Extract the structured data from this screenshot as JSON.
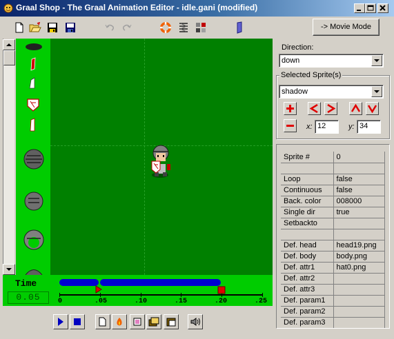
{
  "window": {
    "title": "Graal Shop - The Graal Animation Editor - idle.gani (modified)",
    "controls": [
      "minimize",
      "maximize",
      "close"
    ]
  },
  "toolbar": {
    "icons": [
      "new-file-icon",
      "open-folder-icon",
      "save-icon",
      "save-as-icon",
      "undo-icon",
      "redo-icon",
      "lifebuoy-icon",
      "spring-icon",
      "sprites-icon",
      "book-icon"
    ],
    "movie_mode_label": "-> Movie Mode"
  },
  "colors": {
    "canvas": "#008000",
    "sprite_bg": "#00cc00",
    "timeline_bar": "#0000d0",
    "marker": "#e00000"
  },
  "time": {
    "label": "Time",
    "value": "0.05"
  },
  "timeline": {
    "ticks": [
      "0",
      ".05",
      ".10",
      ".15",
      ".20",
      ".25"
    ],
    "current": 0.05,
    "end": 0.2,
    "max": 0.25
  },
  "direction": {
    "label": "Direction:",
    "value": "down"
  },
  "selected_sprites": {
    "label": "Selected Sprite(s)",
    "value": "shadow",
    "x_label": "x:",
    "x_value": "12",
    "y_label": "y:",
    "y_value": "34"
  },
  "properties": [
    {
      "key": "Sprite #",
      "value": "0"
    },
    {
      "key": "",
      "value": ""
    },
    {
      "key": "Loop",
      "value": "false"
    },
    {
      "key": "Continuous",
      "value": "false"
    },
    {
      "key": "Back. color",
      "value": "008000"
    },
    {
      "key": "Single dir",
      "value": "true"
    },
    {
      "key": "Setbackto",
      "value": ""
    },
    {
      "key": "",
      "value": ""
    },
    {
      "key": "Def. head",
      "value": "head19.png"
    },
    {
      "key": "Def. body",
      "value": "body.png"
    },
    {
      "key": "Def. attr1",
      "value": "hat0.png"
    },
    {
      "key": "Def. attr2",
      "value": ""
    },
    {
      "key": "Def. attr3",
      "value": ""
    },
    {
      "key": "Def. param1",
      "value": ""
    },
    {
      "key": "Def. param2",
      "value": ""
    },
    {
      "key": "Def. param3",
      "value": ""
    }
  ],
  "playback": {
    "icons": [
      "play-icon",
      "stop-icon",
      "new-frame-icon",
      "fire-icon",
      "frame-icon",
      "copy-frame-icon",
      "paste-frame-icon",
      "sound-icon"
    ]
  }
}
